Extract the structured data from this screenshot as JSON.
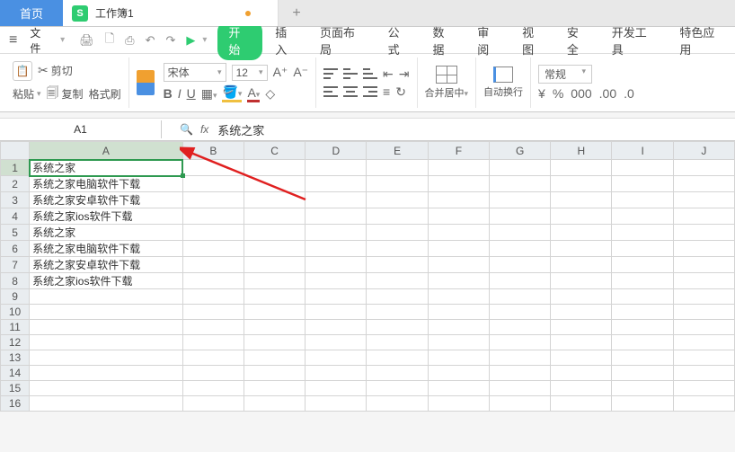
{
  "tabs": {
    "home": "首页",
    "file": "工作簿1"
  },
  "menu": {
    "file": "文件",
    "items": [
      "开始",
      "插入",
      "页面布局",
      "公式",
      "数据",
      "审阅",
      "视图",
      "安全",
      "开发工具",
      "特色应用"
    ]
  },
  "ribbon": {
    "cut": "剪切",
    "paste": "粘贴",
    "copy": "复制",
    "format_painter": "格式刷",
    "font": "宋体",
    "size": "12",
    "merge": "合并居中",
    "wrap": "自动换行",
    "numfmt": "常规",
    "curr": "¥",
    "pct": "%",
    "comma": "000",
    "dec_inc": ".00",
    "dec_dec": ".0"
  },
  "formula": {
    "cell": "A1",
    "value": "系统之家"
  },
  "columns": [
    "A",
    "B",
    "C",
    "D",
    "E",
    "F",
    "G",
    "H",
    "I",
    "J"
  ],
  "rows": [
    "系统之家",
    "系统之家电脑软件下载",
    "系统之家安卓软件下载",
    "系统之家ios软件下载",
    "系统之家",
    "系统之家电脑软件下载",
    "系统之家安卓软件下载",
    "系统之家ios软件下载",
    "",
    "",
    "",
    "",
    "",
    "",
    "",
    ""
  ]
}
